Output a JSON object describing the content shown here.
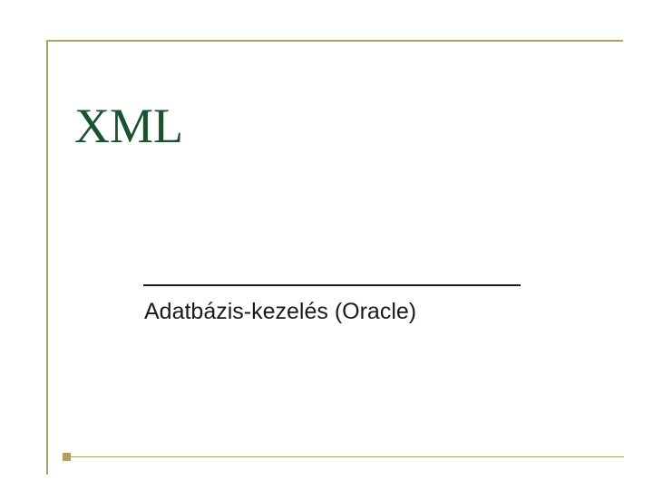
{
  "slide": {
    "title": "XML",
    "subtitle": "Adatbázis-kezelés (Oracle)"
  },
  "colors": {
    "accent": "#b0a060",
    "title": "#1a5230",
    "text": "#1a1a1a",
    "background": "#ffffff"
  }
}
